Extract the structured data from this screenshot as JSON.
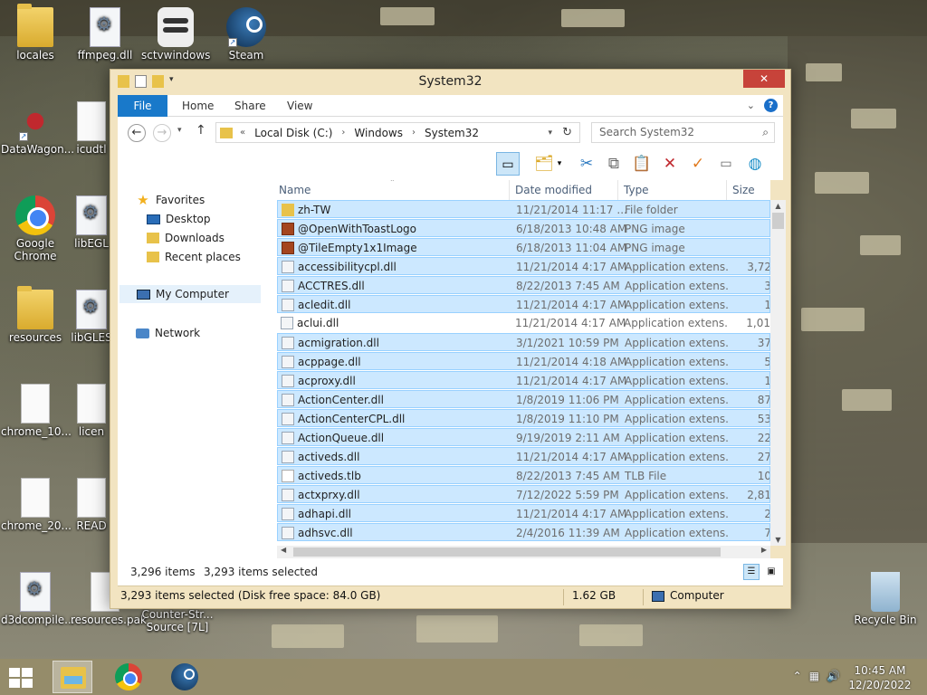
{
  "desktop": {
    "icons": [
      {
        "label": "locales"
      },
      {
        "label": "ffmpeg.dll"
      },
      {
        "label": "sctvwindows"
      },
      {
        "label": "Steam"
      },
      {
        "label": "DataWagon..."
      },
      {
        "label": "icudtl"
      },
      {
        "label": "Google Chrome"
      },
      {
        "label": "libEGL"
      },
      {
        "label": "resources"
      },
      {
        "label": "libGLES"
      },
      {
        "label": "chrome_10..."
      },
      {
        "label": "licen"
      },
      {
        "label": "chrome_20..."
      },
      {
        "label": "READ"
      },
      {
        "label": "d3dcompile..."
      },
      {
        "label": "resources.pak"
      },
      {
        "label": "Counter-Str... Source [7L]"
      },
      {
        "label": "Recycle Bin"
      }
    ]
  },
  "window": {
    "title": "System32",
    "close_glyph": "✕",
    "ribbon_tabs": [
      "File",
      "Home",
      "Share",
      "View"
    ],
    "address": {
      "overflow": "«",
      "crumbs": [
        "Local Disk (C:)",
        "Windows",
        "System32"
      ]
    },
    "search_placeholder": "Search System32",
    "navpane": {
      "favorites": "Favorites",
      "desktop": "Desktop",
      "downloads": "Downloads",
      "recent": "Recent places",
      "my_computer": "My Computer",
      "network": "Network"
    },
    "columns": [
      "Name",
      "Date modified",
      "Type",
      "Size"
    ],
    "rows": [
      {
        "name": "zh-TW",
        "date": "11/21/2014 11:17 ...",
        "type": "File folder",
        "size": "",
        "icon": "folder",
        "selected": true
      },
      {
        "name": "@OpenWithToastLogo",
        "date": "6/18/2013 10:48 AM",
        "type": "PNG image",
        "size": "",
        "icon": "png",
        "selected": true
      },
      {
        "name": "@TileEmpty1x1Image",
        "date": "6/18/2013 11:04 AM",
        "type": "PNG image",
        "size": "",
        "icon": "png",
        "selected": true
      },
      {
        "name": "accessibilitycpl.dll",
        "date": "11/21/2014 4:17 AM",
        "type": "Application extens...",
        "size": "3,72",
        "icon": "dll",
        "selected": true
      },
      {
        "name": "ACCTRES.dll",
        "date": "8/22/2013 7:45 AM",
        "type": "Application extens...",
        "size": "3",
        "icon": "dll",
        "selected": true
      },
      {
        "name": "acledit.dll",
        "date": "11/21/2014 4:17 AM",
        "type": "Application extens...",
        "size": "1",
        "icon": "dll",
        "selected": true
      },
      {
        "name": "aclui.dll",
        "date": "11/21/2014 4:17 AM",
        "type": "Application extens...",
        "size": "1,01",
        "icon": "dll",
        "selected": false
      },
      {
        "name": "acmigration.dll",
        "date": "3/1/2021 10:59 PM",
        "type": "Application extens...",
        "size": "37",
        "icon": "dll",
        "selected": true
      },
      {
        "name": "acppage.dll",
        "date": "11/21/2014 4:18 AM",
        "type": "Application extens...",
        "size": "5",
        "icon": "dll",
        "selected": true
      },
      {
        "name": "acproxy.dll",
        "date": "11/21/2014 4:17 AM",
        "type": "Application extens...",
        "size": "1",
        "icon": "dll",
        "selected": true
      },
      {
        "name": "ActionCenter.dll",
        "date": "1/8/2019 11:06 PM",
        "type": "Application extens...",
        "size": "87",
        "icon": "dll",
        "selected": true
      },
      {
        "name": "ActionCenterCPL.dll",
        "date": "1/8/2019 11:10 PM",
        "type": "Application extens...",
        "size": "53",
        "icon": "dll",
        "selected": true
      },
      {
        "name": "ActionQueue.dll",
        "date": "9/19/2019 2:11 AM",
        "type": "Application extens...",
        "size": "22",
        "icon": "dll",
        "selected": true
      },
      {
        "name": "activeds.dll",
        "date": "11/21/2014 4:17 AM",
        "type": "Application extens...",
        "size": "27",
        "icon": "dll",
        "selected": true
      },
      {
        "name": "activeds.tlb",
        "date": "8/22/2013 7:45 AM",
        "type": "TLB File",
        "size": "10",
        "icon": "tlb",
        "selected": true
      },
      {
        "name": "actxprxy.dll",
        "date": "7/12/2022 5:59 PM",
        "type": "Application extens...",
        "size": "2,81",
        "icon": "dll",
        "selected": true
      },
      {
        "name": "adhapi.dll",
        "date": "11/21/2014 4:17 AM",
        "type": "Application extens...",
        "size": "2",
        "icon": "dll",
        "selected": true
      },
      {
        "name": "adhsvc.dll",
        "date": "2/4/2016 11:39 AM",
        "type": "Application extens...",
        "size": "7",
        "icon": "dll",
        "selected": true
      }
    ],
    "status": {
      "item_count": "3,296 items",
      "selected_count": "3,293 items selected",
      "detail": "3,293 items selected (Disk free space: 84.0 GB)",
      "size": "1.62 GB",
      "location": "Computer"
    }
  },
  "taskbar": {
    "time": "10:45 AM",
    "date": "12/20/2022"
  }
}
